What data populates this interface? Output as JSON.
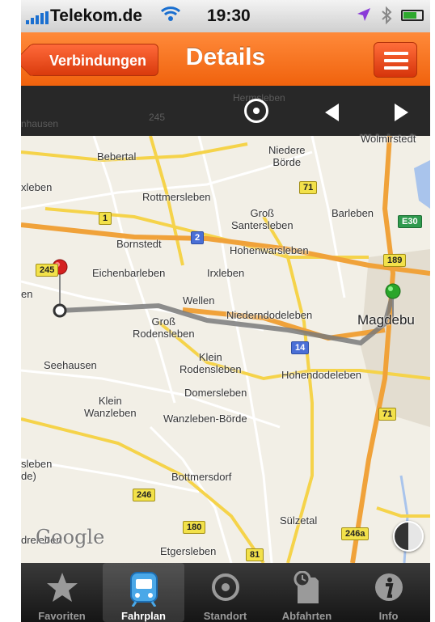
{
  "status_bar": {
    "carrier": "Telekom.de",
    "time": "19:30"
  },
  "nav": {
    "back_label": "Verbindungen",
    "title": "Details"
  },
  "toolbar_faded_labels": [
    "nhausen",
    "245",
    "Hermsleben"
  ],
  "map": {
    "labels": {
      "wolmirstedt": "Wolmirstedt",
      "bebertal": "Bebertal",
      "niedere_boerde": "Niedere\nBörde",
      "erxleben": "xleben",
      "rottmersleben": "Rottmersleben",
      "gross_santersleben": "Groß\nSantersleben",
      "barleben": "Barleben",
      "bornstedt": "Bornstedt",
      "hohenwarsleben": "Hohenwarsleben",
      "eichenbarleben": "Eichenbarleben",
      "irxleben": "Irxleben",
      "wellen": "Wellen",
      "niederndodeleben": "Niederndodeleben",
      "magdeburg": "Magdebu",
      "gross_rodensleben": "Groß\nRodensleben",
      "klein_rodensleben": "Klein\nRodensleben",
      "seehausen": "Seehausen",
      "hohendodeleben": "Hohendodeleben",
      "domersleben": "Domersleben",
      "klein_wanzleben": "Klein\nWanzleben",
      "wanzleben_boerde": "Wanzleben-Börde",
      "sleben": "sleben\nde)",
      "bottmersdorf": "Bottmersdorf",
      "suelzetal": "Sülzetal",
      "dreleben": "dreleben",
      "etgersleben": "Etgersleben",
      "en": "en"
    },
    "shields": {
      "b245_top": "245",
      "b71_a": "71",
      "b1": "1",
      "a2": "2",
      "e30": "E30",
      "b189": "189",
      "b245": "245",
      "a14": "14",
      "b71_b": "71",
      "b246": "246",
      "b180": "180",
      "b246a": "246a",
      "b81": "81"
    },
    "logo": "Google",
    "route_start_color": "#d42020",
    "route_end_color": "#2aa52a",
    "route_color": "#7a7a7a"
  },
  "tabs": [
    {
      "label": "Favoriten",
      "icon": "star-icon",
      "active": false
    },
    {
      "label": "Fahrplan",
      "icon": "train-icon",
      "active": true
    },
    {
      "label": "Standort",
      "icon": "location-icon",
      "active": false
    },
    {
      "label": "Abfahrten",
      "icon": "departures-icon",
      "active": false
    },
    {
      "label": "Info",
      "icon": "info-icon",
      "active": false
    }
  ],
  "colors": {
    "nav_orange": "#f26a17",
    "tab_active": "#4aa8e8"
  }
}
